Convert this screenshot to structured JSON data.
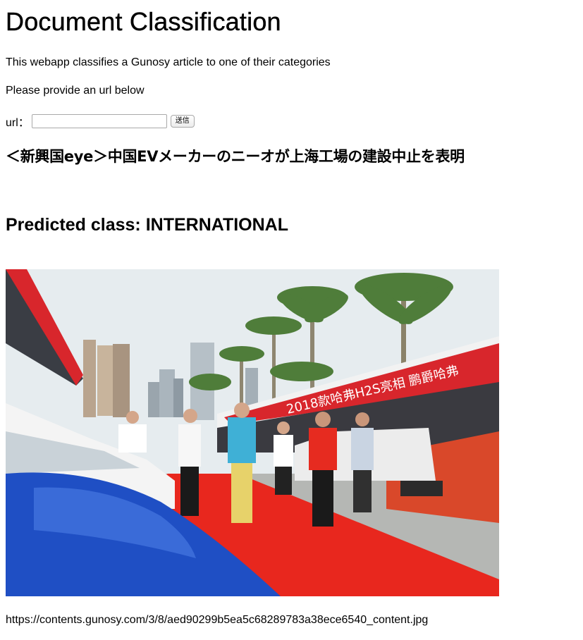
{
  "page": {
    "title": "Document Classification",
    "description": "This webapp classifies a Gunosy article to one of their categories",
    "prompt": "Please provide an url below"
  },
  "form": {
    "url_label": "url：",
    "url_value": "",
    "submit_label": "送信"
  },
  "article": {
    "title": "＜新興国eye＞中国EVメーカーのニーオが上海工場の建設中止を表明",
    "predicted_class_text": "Predicted class: INTERNATIONAL",
    "image_url": "https://contents.gunosy.com/3/8/aed90299b5ea5c68289783a38ece6540_content.jpg",
    "image_banner_text": "2018款哈弗H2S亮相 鹏爵哈弗"
  },
  "colors": {
    "banner_red": "#d8262c",
    "carpet_red": "#e8271e",
    "sky": "#e6ecef",
    "car_blue": "#1f4fc4"
  }
}
